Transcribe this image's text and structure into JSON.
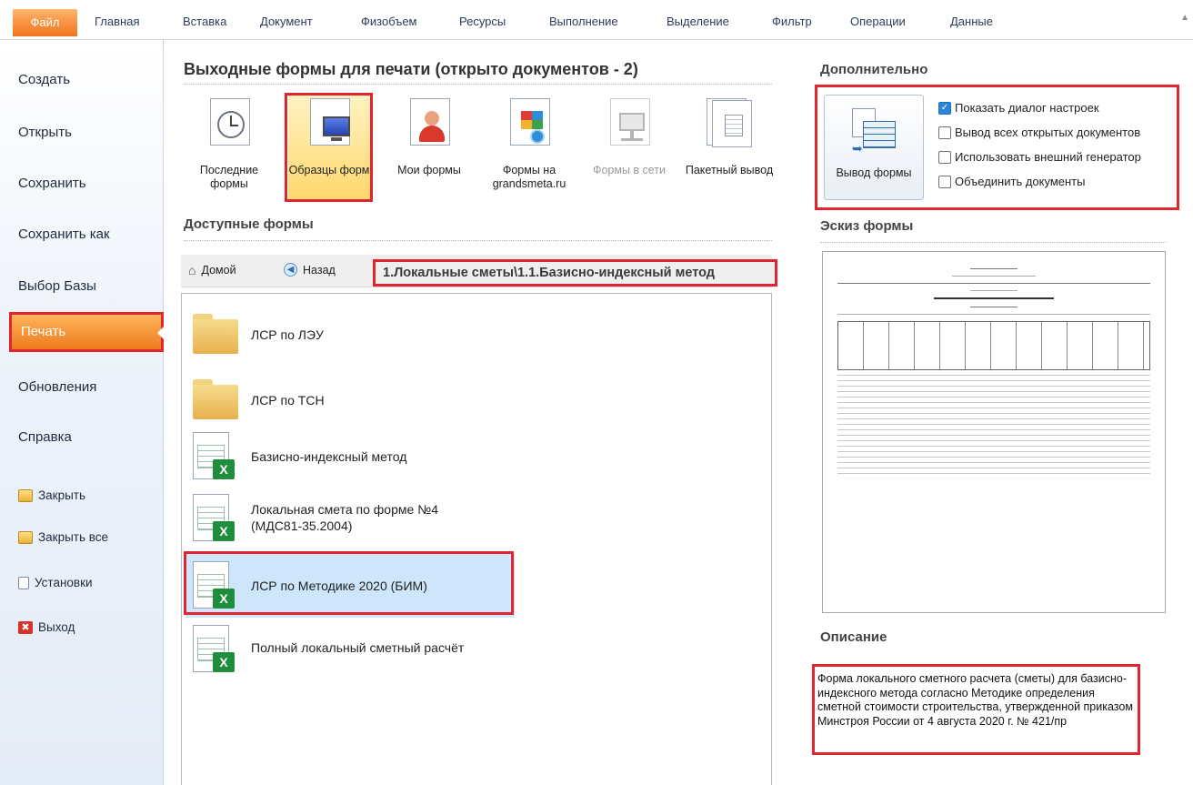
{
  "ribbon": {
    "tabs": [
      "Файл",
      "Главная",
      "Вставка",
      "Документ",
      "Физобъем",
      "Ресурсы",
      "Выполнение",
      "Выделение",
      "Фильтр",
      "Операции",
      "Данные"
    ]
  },
  "sidebar": {
    "items": [
      "Создать",
      "Открыть",
      "Сохранить",
      "Сохранить как",
      "Выбор Базы",
      "Печать",
      "Обновления",
      "Справка"
    ],
    "small_items": [
      "Закрыть",
      "Закрыть все",
      "Установки",
      "Выход"
    ],
    "active": "Печать"
  },
  "main": {
    "title": "Выходные формы для печати (открыто документов - 2)",
    "tools": [
      {
        "label": "Последние формы",
        "icon": "clock-icon",
        "state": "normal"
      },
      {
        "label": "Образцы форм",
        "icon": "monitor-icon",
        "state": "selected"
      },
      {
        "label": "Мои формы",
        "icon": "user-icon",
        "state": "normal"
      },
      {
        "label": "Формы на grandsmeta.ru",
        "icon": "web-icon",
        "state": "normal"
      },
      {
        "label": "Формы в сети",
        "icon": "network-icon",
        "state": "disabled"
      },
      {
        "label": "Пакетный вывод",
        "icon": "batch-icon",
        "state": "normal"
      }
    ],
    "available_title": "Доступные формы",
    "home_label": "Домой",
    "back_label": "Назад",
    "path": "1.Локальные сметы\\1.1.Базисно-индексный метод",
    "files": [
      {
        "label": "ЛСР по ЛЭУ",
        "type": "folder"
      },
      {
        "label": "ЛСР по ТСН",
        "type": "folder"
      },
      {
        "label": "Базисно-индексный метод",
        "type": "xls"
      },
      {
        "label": "Локальная смета по форме №4",
        "label2": "(МДС81-35.2004)",
        "type": "xls"
      },
      {
        "label": "ЛСР по Методике 2020 (БИМ)",
        "type": "xls",
        "selected": true
      },
      {
        "label": "Полный локальный сметный расчёт",
        "type": "xls"
      }
    ]
  },
  "right": {
    "extra_title": "Дополнительно",
    "output_button": "Вывод формы",
    "options": [
      {
        "label": "Показать диалог настроек",
        "checked": true
      },
      {
        "label": "Вывод всех открытых документов",
        "checked": false
      },
      {
        "label": "Использовать внешний генератор",
        "checked": false
      },
      {
        "label": "Объединить документы",
        "checked": false
      }
    ],
    "sketch_title": "Эскиз формы",
    "description_title": "Описание",
    "description": "Форма локального сметного расчета (сметы) для базисно-индексного метода согласно Методике определения сметной стоимости строительства, утвержденной приказом Минстроя России от 4 августа 2020 г. № 421/пр"
  },
  "colors": {
    "accent": "#f0731e",
    "highlight": "#e0252f",
    "selection": "#cde6fb"
  }
}
